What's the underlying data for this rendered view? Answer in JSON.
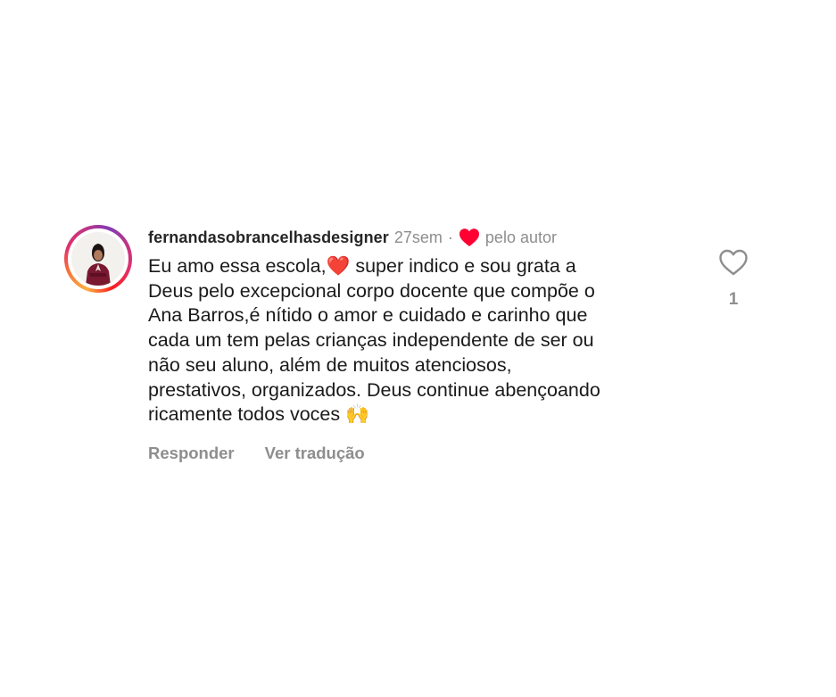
{
  "comment": {
    "username": "fernandasobrancelhasdesigner",
    "timestamp": "27sem",
    "separator": "·",
    "author_like_label": "pelo autor",
    "text": "Eu amo essa escola,❤️ super indico e sou grata a\nDeus pelo excepcional corpo docente que compõe o\nAna Barros,é nítido o amor e cuidado e carinho que\ncada um tem pelas crianças independente de ser ou\nnão seu aluno, além de muitos atenciosos,\nprestativos, organizados. Deus continue abençoando\nricamente todos voces 🙌",
    "actions": {
      "reply": "Responder",
      "translate": "Ver tradução"
    },
    "likes": {
      "count": "1",
      "icon": "heart-outline-icon"
    },
    "author_heart_icon": "heart-filled-icon",
    "colors": {
      "author_heart": "#ff0033",
      "secondary_text": "#8e8e8e",
      "primary_text": "#262626"
    }
  }
}
